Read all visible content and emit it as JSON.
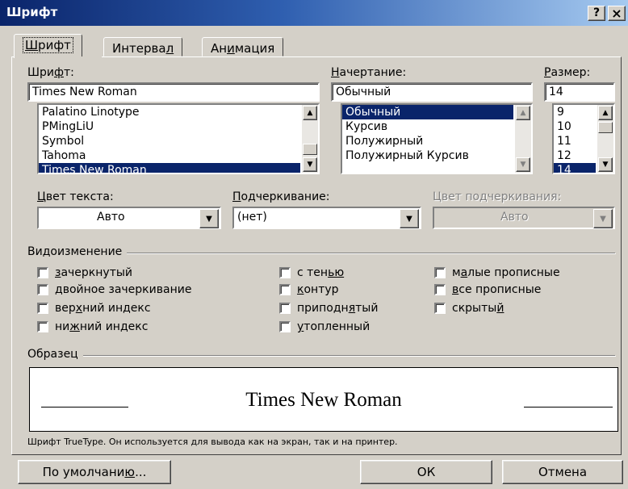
{
  "window": {
    "title": "Шрифт",
    "help_label": "?",
    "close_label": "×"
  },
  "tabs": [
    {
      "pre": "",
      "u": "Ш",
      "post": "рифт",
      "active": true
    },
    {
      "pre": "Интерва",
      "u": "л",
      "post": "",
      "active": false
    },
    {
      "pre": "Ан",
      "u": "и",
      "post": "мация",
      "active": false
    }
  ],
  "font": {
    "label_pre": "Шри",
    "label_u": "ф",
    "label_post": "т:",
    "value": "Times New Roman",
    "items": [
      "Palatino Linotype",
      "PMingLiU",
      "Symbol",
      "Tahoma",
      "Times New Roman"
    ]
  },
  "style": {
    "label_pre": "",
    "label_u": "Н",
    "label_post": "ачертание:",
    "value": "Обычный",
    "items": [
      "Обычный",
      "Курсив",
      "Полужирный",
      "Полужирный Курсив"
    ]
  },
  "size": {
    "label_pre": "",
    "label_u": "Р",
    "label_post": "азмер:",
    "value": "14",
    "items": [
      "9",
      "10",
      "11",
      "12",
      "14"
    ]
  },
  "color": {
    "label_pre": "",
    "label_u": "Ц",
    "label_post": "вет текста:",
    "value": "Авто"
  },
  "underline": {
    "label_pre": "",
    "label_u": "П",
    "label_post": "одчеркивание:",
    "value": "(нет)"
  },
  "underline_color": {
    "label": "Цвет подчеркивания:",
    "value": "Авто"
  },
  "effects": {
    "label": "Видоизменение",
    "col1": [
      {
        "pre": "",
        "u": "з",
        "post": "ачеркнутый",
        "name": "strikethrough-checkbox"
      },
      {
        "pre": "",
        "u": "д",
        "post": "войное зачеркивание",
        "name": "double-strikethrough-checkbox"
      },
      {
        "pre": "вер",
        "u": "х",
        "post": "ний индекс",
        "name": "superscript-checkbox"
      },
      {
        "pre": "ни",
        "u": "ж",
        "post": "ний индекс",
        "name": "subscript-checkbox"
      }
    ],
    "col2": [
      {
        "pre": "с тен",
        "u": "ью",
        "post": "",
        "name": "shadow-checkbox"
      },
      {
        "pre": "",
        "u": "к",
        "post": "онтур",
        "name": "outline-checkbox"
      },
      {
        "pre": "приподн",
        "u": "я",
        "post": "тый",
        "name": "emboss-checkbox"
      },
      {
        "pre": "",
        "u": "у",
        "post": "топленный",
        "name": "engrave-checkbox"
      }
    ],
    "col3": [
      {
        "pre": "м",
        "u": "а",
        "post": "лые прописные",
        "name": "small-caps-checkbox"
      },
      {
        "pre": "",
        "u": "в",
        "post": "се прописные",
        "name": "all-caps-checkbox"
      },
      {
        "pre": "скрыты",
        "u": "й",
        "post": "",
        "name": "hidden-checkbox"
      }
    ]
  },
  "preview": {
    "label": "Образец",
    "text": "Times New Roman"
  },
  "info_text": "Шрифт TrueType. Он используется для вывода как на экран, так и на принтер.",
  "buttons": {
    "default_pre": "По умолчани",
    "default_u": "ю",
    "default_post": "...",
    "ok": "ОК",
    "cancel": "Отмена"
  },
  "colors": {
    "titlebar": "#0a246a",
    "selection": "#0a246a",
    "face": "#d4d0c8"
  }
}
